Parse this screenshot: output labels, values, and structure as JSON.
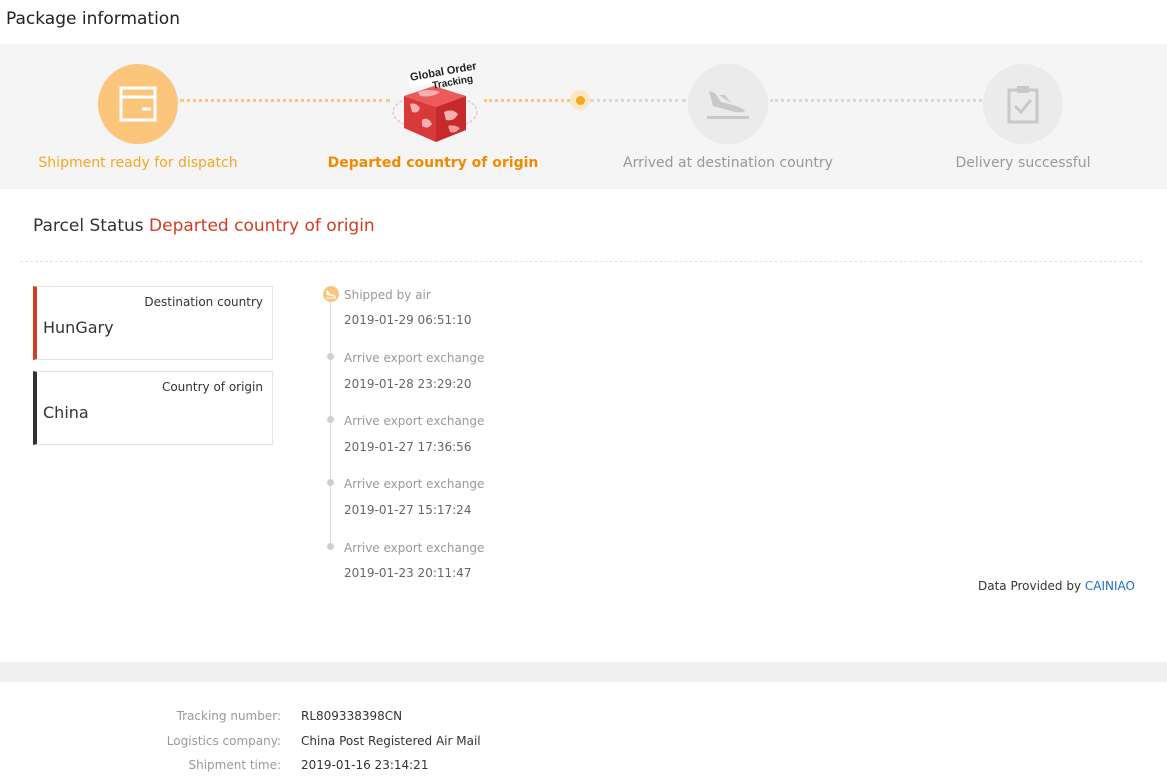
{
  "page": {
    "title": "Package information"
  },
  "progress": {
    "badge_text_1": "Global Order",
    "badge_text_2": "Tracking",
    "steps": [
      {
        "label": "Shipment ready for dispatch",
        "icon": "package-box-icon",
        "state": "done"
      },
      {
        "label": "Departed country of origin",
        "icon": "global-order-tracking-box-icon",
        "state": "current"
      },
      {
        "label": "Arrived at destination country",
        "icon": "airplane-landing-icon",
        "state": "pending"
      },
      {
        "label": "Delivery successful",
        "icon": "clipboard-check-icon",
        "state": "pending"
      }
    ]
  },
  "parcel_status": {
    "label": "Parcel Status",
    "value": "Departed country of origin"
  },
  "countries": {
    "destination": {
      "title": "Destination country",
      "value": "HunGary"
    },
    "origin": {
      "title": "Country of origin",
      "value": "China"
    }
  },
  "events": [
    {
      "title": "Shipped by air",
      "time": "2019-01-29 06:51:10"
    },
    {
      "title": "Arrive export exchange",
      "time": "2019-01-28 23:29:20"
    },
    {
      "title": "Arrive export exchange",
      "time": "2019-01-27 17:36:56"
    },
    {
      "title": "Arrive export exchange",
      "time": "2019-01-27 15:17:24"
    },
    {
      "title": "Arrive export exchange",
      "time": "2019-01-23 20:11:47"
    }
  ],
  "credit": {
    "prefix": "Data Provided by",
    "provider": "CAINIAO"
  },
  "shipment_info": [
    {
      "label": "Tracking number:",
      "value": "RL809338398CN"
    },
    {
      "label": "Logistics company:",
      "value": "China Post Registered Air Mail"
    },
    {
      "label": "Shipment time:",
      "value": "2019-01-16 23:14:21"
    }
  ],
  "colors": {
    "accent_orange": "#f5a623",
    "status_red": "#d43c20",
    "link_blue": "#1a6fc9"
  }
}
